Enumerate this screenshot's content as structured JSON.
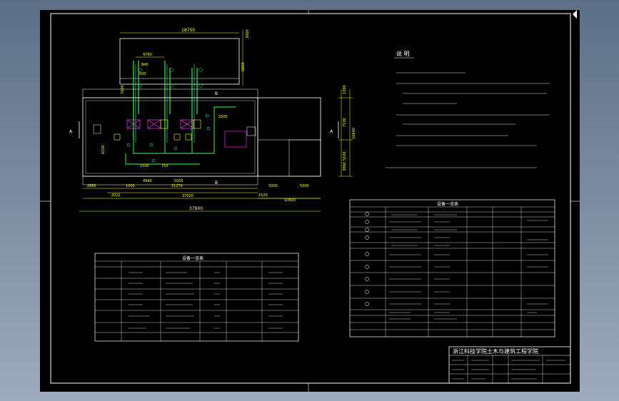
{
  "drawing": {
    "notes_title": "说 明",
    "equipment_table_title": "设备一览表",
    "pipe_table_title": "设备一览表",
    "title_block": {
      "school": "浙江科技学院土木与建筑工程学院"
    },
    "section_marks": [
      "A",
      "A"
    ],
    "room_marks": [
      "B",
      "B"
    ],
    "dimensions": {
      "top_width": "18750",
      "d4760": "4760",
      "d840": "840",
      "d500": "500",
      "d6100": "6100",
      "d1500": "1500",
      "d750": "750",
      "d2505": "2505",
      "d5005": "5005",
      "d4940": "4940",
      "d21270": "21270",
      "d2880": "2880",
      "d2022": "2022",
      "d37020": "37020",
      "d37800": "37800",
      "d1520": "1520",
      "d10800": "10800",
      "d5000a": "5000",
      "d5000b": "5000",
      "d1300": "1300",
      "d7100": "7100",
      "d16640": "16640",
      "d5100": "5100",
      "d3860": "3860",
      "d7600": "7600",
      "d3000": "3000",
      "d1000": "1000",
      "d6800": "6800"
    }
  }
}
